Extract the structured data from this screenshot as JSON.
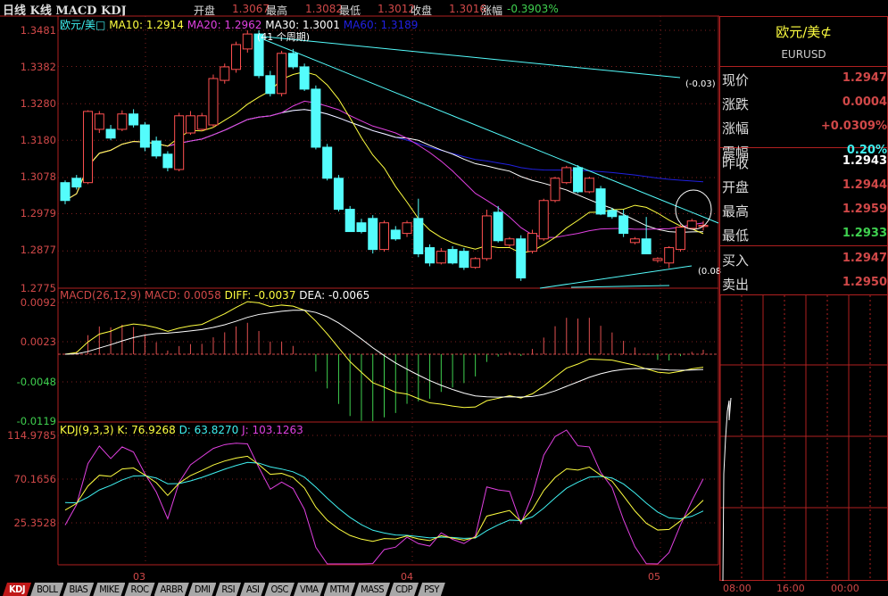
{
  "header": {
    "title": "日线 K线 MACD KDJ",
    "open_label": "开盘",
    "open": "1.3067",
    "high_label": "最高",
    "high": "1.3082",
    "low_label": "最低",
    "low": "1.3012",
    "close_label": "收盘",
    "close": "1.3016",
    "change_label": "涨幅",
    "change": "-0.3903%"
  },
  "main_legend": {
    "symbol": "欧元/美□",
    "ma10": "MA10: 1.2914",
    "ma20": "MA20: 1.2962",
    "ma30": "MA30: 1.3001",
    "ma60": "MA60: 1.3189"
  },
  "price_axis": [
    "1.3481",
    "1.3382",
    "1.3280",
    "1.3180",
    "1.3078",
    "1.2979",
    "1.2877",
    "1.2775"
  ],
  "annotations": {
    "period": "(41 个周期)",
    "slope1": "(-0.03)",
    "slope2": "(0.08"
  },
  "macd": {
    "legend": "MACD(26,12,9)",
    "macd": "MACD: 0.0058",
    "diff": "DIFF: -0.0037",
    "dea": "DEA: -0.0065",
    "axis": [
      "0.0092",
      "0.0023",
      "-0.0048",
      "-0.0119"
    ]
  },
  "kdj": {
    "legend": "KDJ(9,3,3)",
    "k": "K: 76.9268",
    "d": "D: 63.8270",
    "j": "J: 103.1263",
    "axis": [
      "114.9785",
      "70.1656",
      "25.3528"
    ]
  },
  "x_axis": [
    "03",
    "04",
    "05"
  ],
  "colors": {
    "bull": "#ff5050",
    "bear": "#54fcfc",
    "ma10": "#ffff40",
    "ma20": "#e040e0",
    "ma30": "#ffffff",
    "ma60": "#2020e0",
    "border": "#b02020"
  },
  "quote": {
    "name": "欧元/美⊄",
    "code": "EURUSD",
    "rows": [
      {
        "label": "现价",
        "value": "1.2947",
        "color": "#d04848"
      },
      {
        "label": "涨跌",
        "value": "0.0004",
        "color": "#d04848"
      },
      {
        "label": "涨幅",
        "value": "+0.0309%",
        "color": "#d04848"
      },
      {
        "label": "震幅",
        "value": "0.20%",
        "color": "#3ff0f0"
      },
      {
        "label": "昨收",
        "value": "1.2943",
        "color": "#ffffff"
      },
      {
        "label": "开盘",
        "value": "1.2944",
        "color": "#d04848"
      },
      {
        "label": "最高",
        "value": "1.2959",
        "color": "#d04848"
      },
      {
        "label": "最低",
        "value": "1.2933",
        "color": "#3fd04f"
      },
      {
        "label": "买入",
        "value": "1.2947",
        "color": "#d04848"
      },
      {
        "label": "卖出",
        "value": "1.2950",
        "color": "#d04848"
      }
    ]
  },
  "intraday_axis": [
    "08:00",
    "16:00",
    "00:00"
  ],
  "tabs": [
    "KDJ",
    "BOLL",
    "BIAS",
    "MIKE",
    "ROC",
    "ARBR",
    "DMI",
    "RSI",
    "ASI",
    "OSC",
    "VMA",
    "MTM",
    "MASS",
    "CDP",
    "PSY"
  ],
  "active_tab": "KDJ",
  "chart_data": {
    "type": "candlestick",
    "ylim": [
      1.2775,
      1.3481
    ],
    "x_ticks": [
      "03",
      "04",
      "05"
    ],
    "ohlc": [
      [
        1.3064,
        1.307,
        1.3005,
        1.3015
      ],
      [
        1.3076,
        1.3085,
        1.3045,
        1.3052
      ],
      [
        1.3064,
        1.3262,
        1.306,
        1.3259
      ],
      [
        1.321,
        1.326,
        1.32,
        1.3252
      ],
      [
        1.321,
        1.3222,
        1.318,
        1.3186
      ],
      [
        1.321,
        1.3262,
        1.3205,
        1.3252
      ],
      [
        1.3252,
        1.3265,
        1.3215,
        1.3222
      ],
      [
        1.3222,
        1.323,
        1.315,
        1.3161
      ],
      [
        1.3178,
        1.319,
        1.313,
        1.3137
      ],
      [
        1.3142,
        1.315,
        1.3095,
        1.3105
      ],
      [
        1.31,
        1.3255,
        1.3095,
        1.3247
      ],
      [
        1.32,
        1.326,
        1.3195,
        1.3247
      ],
      [
        1.321,
        1.3255,
        1.3205,
        1.3247
      ],
      [
        1.3222,
        1.336,
        1.3215,
        1.3349
      ],
      [
        1.3344,
        1.339,
        1.3335,
        1.3381
      ],
      [
        1.3374,
        1.345,
        1.3365,
        1.3442
      ],
      [
        1.343,
        1.3481,
        1.342,
        1.3471
      ],
      [
        1.3471,
        1.3481,
        1.335,
        1.3357
      ],
      [
        1.3357,
        1.337,
        1.33,
        1.3308
      ],
      [
        1.3308,
        1.3425,
        1.33,
        1.3418
      ],
      [
        1.3418,
        1.343,
        1.3375,
        1.3381
      ],
      [
        1.3381,
        1.339,
        1.3315,
        1.332
      ],
      [
        1.332,
        1.333,
        1.3155,
        1.3161
      ],
      [
        1.3161,
        1.317,
        1.307,
        1.3076
      ],
      [
        1.3076,
        1.3085,
        1.2985,
        1.2991
      ],
      [
        1.2991,
        1.3,
        1.2935,
        1.293
      ],
      [
        1.2954,
        1.2965,
        1.2925,
        1.293
      ],
      [
        1.2966,
        1.2975,
        1.287,
        1.2881
      ],
      [
        1.2881,
        1.296,
        1.2875,
        1.2954
      ],
      [
        1.2934,
        1.2945,
        1.2905,
        1.291
      ],
      [
        1.2925,
        1.296,
        1.2915,
        1.2954
      ],
      [
        1.2966,
        1.302,
        1.286,
        1.2869
      ],
      [
        1.2886,
        1.2895,
        1.2835,
        1.2844
      ],
      [
        1.2844,
        1.2885,
        1.284,
        1.2876
      ],
      [
        1.2881,
        1.289,
        1.284,
        1.2844
      ],
      [
        1.2876,
        1.2885,
        1.2825,
        1.2832
      ],
      [
        1.2832,
        1.286,
        1.2828,
        1.2856
      ],
      [
        1.2856,
        1.299,
        1.285,
        1.2973
      ],
      [
        1.2983,
        1.3,
        1.29,
        1.2905
      ],
      [
        1.2893,
        1.2915,
        1.2888,
        1.291
      ],
      [
        1.291,
        1.292,
        1.2795,
        1.2803
      ],
      [
        1.2876,
        1.2935,
        1.287,
        1.2925
      ],
      [
        1.291,
        1.302,
        1.2905,
        1.3015
      ],
      [
        1.3015,
        1.308,
        1.301,
        1.3076
      ],
      [
        1.3064,
        1.311,
        1.306,
        1.3105
      ],
      [
        1.3105,
        1.3112,
        1.3035,
        1.3039
      ],
      [
        1.3039,
        1.308,
        1.3035,
        1.3076
      ],
      [
        1.3047,
        1.3055,
        1.2975,
        1.2978
      ],
      [
        1.2988,
        1.2995,
        1.2965,
        1.2971
      ],
      [
        1.2973,
        1.299,
        1.2915,
        1.2925
      ],
      [
        1.29,
        1.2915,
        1.2895,
        1.291
      ],
      [
        1.291,
        1.297,
        1.287,
        1.2869
      ],
      [
        1.2851,
        1.286,
        1.2845,
        1.2856
      ],
      [
        1.2844,
        1.289,
        1.283,
        1.2886
      ],
      [
        1.2881,
        1.295,
        1.2875,
        1.2942
      ],
      [
        1.2939,
        1.2965,
        1.2935,
        1.2959
      ],
      [
        1.2944,
        1.2959,
        1.2933,
        1.2947
      ]
    ],
    "macd_range": [
      -0.0119,
      0.0092
    ],
    "kdj_range": [
      25.3528,
      114.9785
    ]
  }
}
